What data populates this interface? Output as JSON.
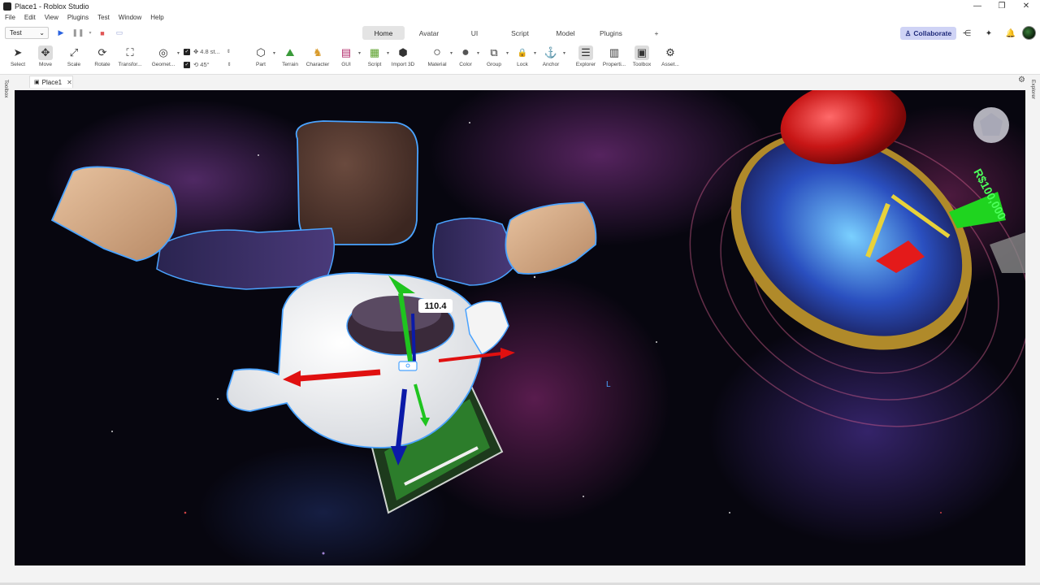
{
  "window": {
    "title": "Place1 - Roblox Studio",
    "controls": [
      "—",
      "❐",
      "✕"
    ]
  },
  "menu": [
    "File",
    "Edit",
    "View",
    "Plugins",
    "Test",
    "Window",
    "Help"
  ],
  "tabbar": {
    "mode": "Test",
    "tabs": [
      "Home",
      "Avatar",
      "UI",
      "Script",
      "Model",
      "Plugins",
      "+"
    ],
    "active_tab": "Home",
    "collaborate_label": "Collaborate"
  },
  "toolbar": {
    "tools": [
      {
        "label": "Select",
        "icon": "cursor-icon",
        "glyph": "➤"
      },
      {
        "label": "Move",
        "icon": "move-icon",
        "glyph": "✥"
      },
      {
        "label": "Scale",
        "icon": "scale-icon",
        "glyph": "⤢"
      },
      {
        "label": "Rotate",
        "icon": "rotate-icon",
        "glyph": "⟳"
      },
      {
        "label": "Transfor...",
        "icon": "transform-icon",
        "glyph": "⛶"
      },
      {
        "label": "Geomet...",
        "icon": "geometry-icon",
        "glyph": "◎"
      }
    ],
    "snap_move": "4.8 st...",
    "snap_rotate": "45°",
    "insert_tools": [
      {
        "label": "Part",
        "icon": "part-icon",
        "glyph": "⬡"
      },
      {
        "label": "Terrain",
        "icon": "terrain-icon",
        "glyph": "⛰"
      },
      {
        "label": "Character",
        "icon": "character-icon",
        "glyph": "♞"
      },
      {
        "label": "GUI",
        "icon": "gui-icon",
        "glyph": "▤"
      },
      {
        "label": "Script",
        "icon": "script-icon",
        "glyph": "▦"
      },
      {
        "label": "Import 3D",
        "icon": "import-3d-icon",
        "glyph": "⬢"
      },
      {
        "label": "Material",
        "icon": "material-icon",
        "glyph": "○"
      },
      {
        "label": "Color",
        "icon": "color-icon",
        "glyph": "●"
      },
      {
        "label": "Group",
        "icon": "group-icon",
        "glyph": "⧉"
      },
      {
        "label": "Lock",
        "icon": "lock-icon",
        "glyph": "🔒"
      },
      {
        "label": "Anchor",
        "icon": "anchor-icon",
        "glyph": "⚓"
      },
      {
        "label": "Explorer",
        "icon": "explorer-icon",
        "glyph": "☰"
      },
      {
        "label": "Properti...",
        "icon": "properties-icon",
        "glyph": "▥"
      },
      {
        "label": "Toolbox",
        "icon": "toolbox-icon",
        "glyph": "▣"
      },
      {
        "label": "Asset...",
        "icon": "asset-manager-icon",
        "glyph": "⚙"
      }
    ]
  },
  "document_tab": {
    "label": "Place1"
  },
  "side_panels": {
    "left": "Toolbox",
    "right": "Explorer"
  },
  "viewport": {
    "gizmo_value": "110.4",
    "billboard_text": "R$100,000"
  },
  "colors": {
    "accent": "#cfd3f5",
    "axis_x": "#e01010",
    "axis_y": "#1fc41f",
    "axis_z": "#0b1aa8",
    "selection": "#4aa3ff"
  }
}
